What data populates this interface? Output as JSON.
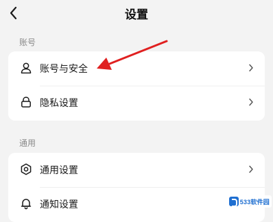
{
  "header": {
    "title": "设置"
  },
  "sections": [
    {
      "label": "账号",
      "items": [
        {
          "label": "账号与安全",
          "icon": "user-icon"
        },
        {
          "label": "隐私设置",
          "icon": "lock-icon"
        }
      ]
    },
    {
      "label": "通用",
      "items": [
        {
          "label": "通用设置",
          "icon": "gear-icon"
        },
        {
          "label": "通知设置",
          "icon": "bell-icon"
        }
      ]
    }
  ],
  "annotation": {
    "color": "#e02020",
    "target": "账号与安全"
  },
  "watermark": {
    "text": "533软件园",
    "color": "#1f6fd1"
  }
}
